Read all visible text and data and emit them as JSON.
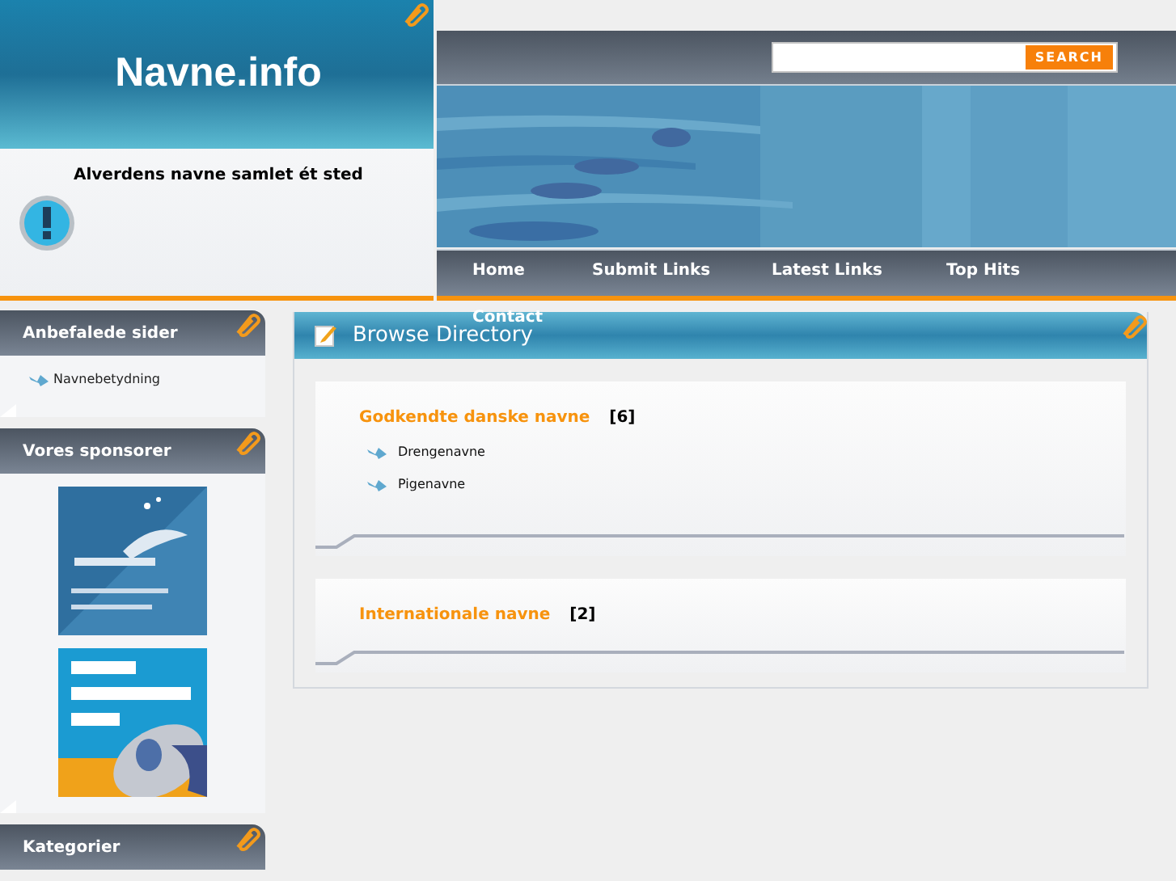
{
  "site": {
    "title": "Navne.info",
    "tagline": "Alverdens navne samlet ét sted"
  },
  "search": {
    "button": "SEARCH"
  },
  "nav": [
    {
      "label": "Home"
    },
    {
      "label": "Submit Links"
    },
    {
      "label": "Latest Links"
    },
    {
      "label": "Top Hits"
    },
    {
      "label": "Contact"
    }
  ],
  "sidebar": [
    {
      "title": "Anbefalede sider",
      "kind": "links",
      "links": [
        "Navnebetydning"
      ]
    },
    {
      "title": "Vores sponsorer",
      "kind": "banners"
    },
    {
      "title": "Kategorier",
      "kind": "links"
    }
  ],
  "main": {
    "title": "Browse Directory",
    "categories": [
      {
        "name": "Godkendte danske navne",
        "count": "[6]",
        "subcategories": [
          "Drengenavne",
          "Pigenavne"
        ]
      },
      {
        "name": "Internationale navne",
        "count": "[2]"
      }
    ]
  }
}
